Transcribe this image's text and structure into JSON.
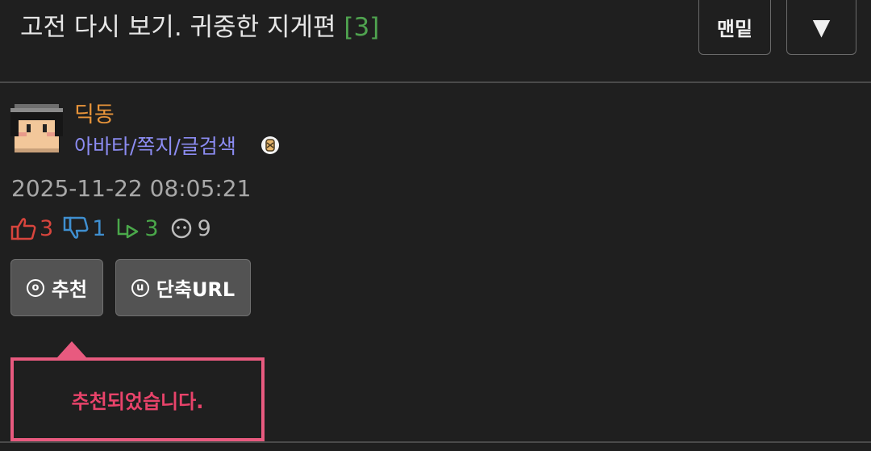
{
  "header": {
    "title": "고전 다시 보기. 귀중한 지게편",
    "comment_count": "[3]",
    "bottom_button": "맨밑",
    "down_button": "▼"
  },
  "author": {
    "nickname": "딕동",
    "links": "아바타/쪽지/글검색",
    "avatar_icon": "pixel-avatar-icon",
    "badge_icon": "level-badge-icon"
  },
  "post": {
    "datetime": "2025-11-22 08:05:21"
  },
  "stats": {
    "upvotes": "3",
    "downvotes": "1",
    "replies": "3",
    "views": "9"
  },
  "actions": {
    "recommend_label": "추천",
    "recommend_icon": "ⓞ",
    "shorturl_label": "단축URL",
    "shorturl_icon": "ⓤ"
  },
  "toast": {
    "message": "추천되었습니다."
  },
  "colors": {
    "background": "#1f1f1f",
    "nickname": "#e8943a",
    "links": "#8c8cf2",
    "comment_count": "#4fa34f",
    "toast_border": "#e85a7f",
    "toast_text": "#e8436a"
  }
}
